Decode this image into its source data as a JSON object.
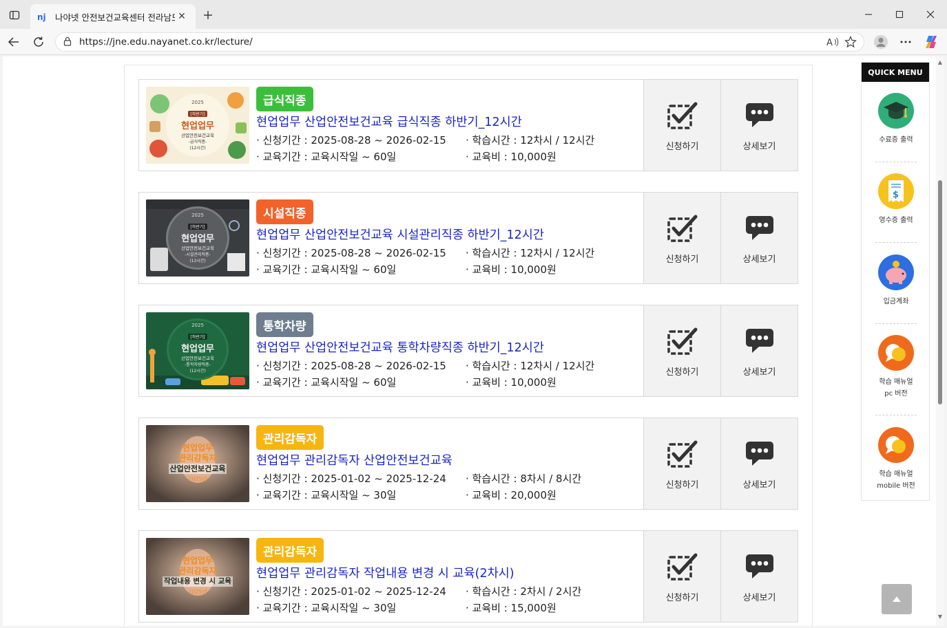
{
  "browser": {
    "tab_title": "나야넷 안전보건교육센터 전라남도",
    "tab_close": "✕",
    "url": "https://jne.edu.nayanet.co.kr/lecture/"
  },
  "quick_menu": {
    "title": "QUICK MENU",
    "items": [
      {
        "label": "수료증 출력",
        "icon": "graduation-cap-icon",
        "color": "#2fae7a"
      },
      {
        "label": "영수증 출력",
        "icon": "receipt-icon",
        "color": "#f7c21e"
      },
      {
        "label": "입금계좌",
        "icon": "piggy-bank-icon",
        "color": "#2d6fe0"
      },
      {
        "label": "학습 매뉴얼",
        "label2": "pc 버전",
        "icon": "chat-bubble-icon",
        "color": "#f06a1c"
      },
      {
        "label": "학습 매뉴얼",
        "label2": "mobile 버전",
        "icon": "chat-bubble-icon",
        "color": "#f06a1c"
      }
    ]
  },
  "actions": {
    "apply_label": "신청하기",
    "detail_label": "상세보기"
  },
  "lectures": [
    {
      "badge": "급식직종",
      "badge_color": "#3bbf3b",
      "title": "현업업무 산업안전보건교육 급식직종 하반기_12시간",
      "apply_period": "· 신청기간 : 2025-08-28 ~ 2026-02-15",
      "study_time": "· 학습시간 : 12차시 / 12시간",
      "edu_period": "· 교육기간 : 교육시작일 ~ 60일",
      "fee": "· 교육비 : 10,000원",
      "thumb": {
        "year": "2025",
        "half": "[하반기]",
        "main": "현업업무",
        "sub1": "산업안전보건교육",
        "sub2": "-급식직종-",
        "sub3": "(12시간)"
      }
    },
    {
      "badge": "시설직종",
      "badge_color": "#f2622b",
      "title": "현업업무 산업안전보건교육 시설관리직종 하반기_12시간",
      "apply_period": "· 신청기간 : 2025-08-28 ~ 2026-02-15",
      "study_time": "· 학습시간 : 12차시 / 12시간",
      "edu_period": "· 교육기간 : 교육시작일 ~ 60일",
      "fee": "· 교육비 : 10,000원",
      "thumb": {
        "year": "2025",
        "half": "[하반기]",
        "main": "현업업무",
        "sub1": "산업안전보건교육",
        "sub2": "-시설관리직종-",
        "sub3": "(12시간)"
      }
    },
    {
      "badge": "통학차량",
      "badge_color": "#6e7e8f",
      "title": "현업업무 산업안전보건교육 통학차량직종 하반기_12시간",
      "apply_period": "· 신청기간 : 2025-08-28 ~ 2026-02-15",
      "study_time": "· 학습시간 : 12차시 / 12시간",
      "edu_period": "· 교육기간 : 교육시작일 ~ 60일",
      "fee": "· 교육비 : 10,000원",
      "thumb": {
        "year": "2025",
        "half": "[하반기]",
        "main": "현업업무",
        "sub1": "산업안전보건교육",
        "sub2": "-통학차량직종-",
        "sub3": "(12시간)"
      }
    },
    {
      "badge": "관리감독자",
      "badge_color": "#f7b512",
      "title": "현업업무 관리감독자 산업안전보건교육",
      "apply_period": "· 신청기간 : 2025-01-02 ~ 2025-12-24",
      "study_time": "· 학습시간 : 8차시 / 8시간",
      "edu_period": "· 교육기간 : 교육시작일 ~ 30일",
      "fee": "· 교육비 : 20,000원",
      "thumb": {
        "line1": "현업업무",
        "line2": "관리감독자",
        "line3": "산업안전보건교육",
        "line4": "2025년"
      }
    },
    {
      "badge": "관리감독자",
      "badge_color": "#f7b512",
      "title": "현업업무 관리감독자 작업내용 변경 시 교육(2차시)",
      "apply_period": "· 신청기간 : 2025-01-02 ~ 2025-12-24",
      "study_time": "· 학습시간 : 2차시 / 2시간",
      "edu_period": "· 교육기간 : 교육시작일 ~ 30일",
      "fee": "· 교육비 : 15,000원",
      "thumb": {
        "line1": "현업업무",
        "line2": "관리감독자",
        "line3": "작업내용 변경 시 교육",
        "line4": "2025년"
      }
    }
  ]
}
